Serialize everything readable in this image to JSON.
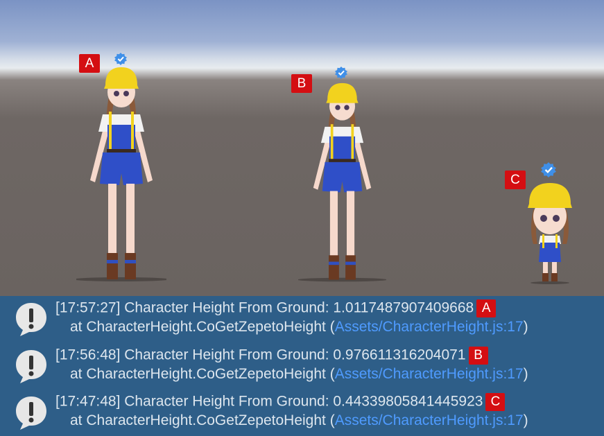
{
  "scene": {
    "characters": [
      {
        "label": "A",
        "scale": 1.0
      },
      {
        "label": "B",
        "scale": 0.976611316204071
      },
      {
        "label": "C",
        "scale": 0.44339805841445923
      }
    ]
  },
  "console": {
    "entries": [
      {
        "time": "[17:57:27]",
        "message": "Character Height From Ground: 1.0117487907409668",
        "tag": "A",
        "trace_prefix": "at CharacterHeight.CoGetZepetoHeight (",
        "trace_link": "Assets/CharacterHeight.js:17",
        "trace_suffix": ")"
      },
      {
        "time": "[17:56:48]",
        "message": "Character Height From Ground: 0.976611316204071",
        "tag": "B",
        "trace_prefix": "at CharacterHeight.CoGetZepetoHeight (",
        "trace_link": "Assets/CharacterHeight.js:17",
        "trace_suffix": ")"
      },
      {
        "time": "[17:47:48]",
        "message": "Character Height From Ground: 0.44339805841445923",
        "tag": "C",
        "trace_prefix": "at CharacterHeight.CoGetZepetoHeight (",
        "trace_link": "Assets/CharacterHeight.js:17",
        "trace_suffix": ")"
      }
    ]
  },
  "colors": {
    "tag": "#d40e12",
    "console_bg": "#2e5e88",
    "link": "#4f9bff",
    "helmet": "#f2d21e",
    "overalls": "#2f4fc8"
  },
  "icons": {
    "select": "check-badge-icon",
    "log": "warning-speech-icon"
  }
}
